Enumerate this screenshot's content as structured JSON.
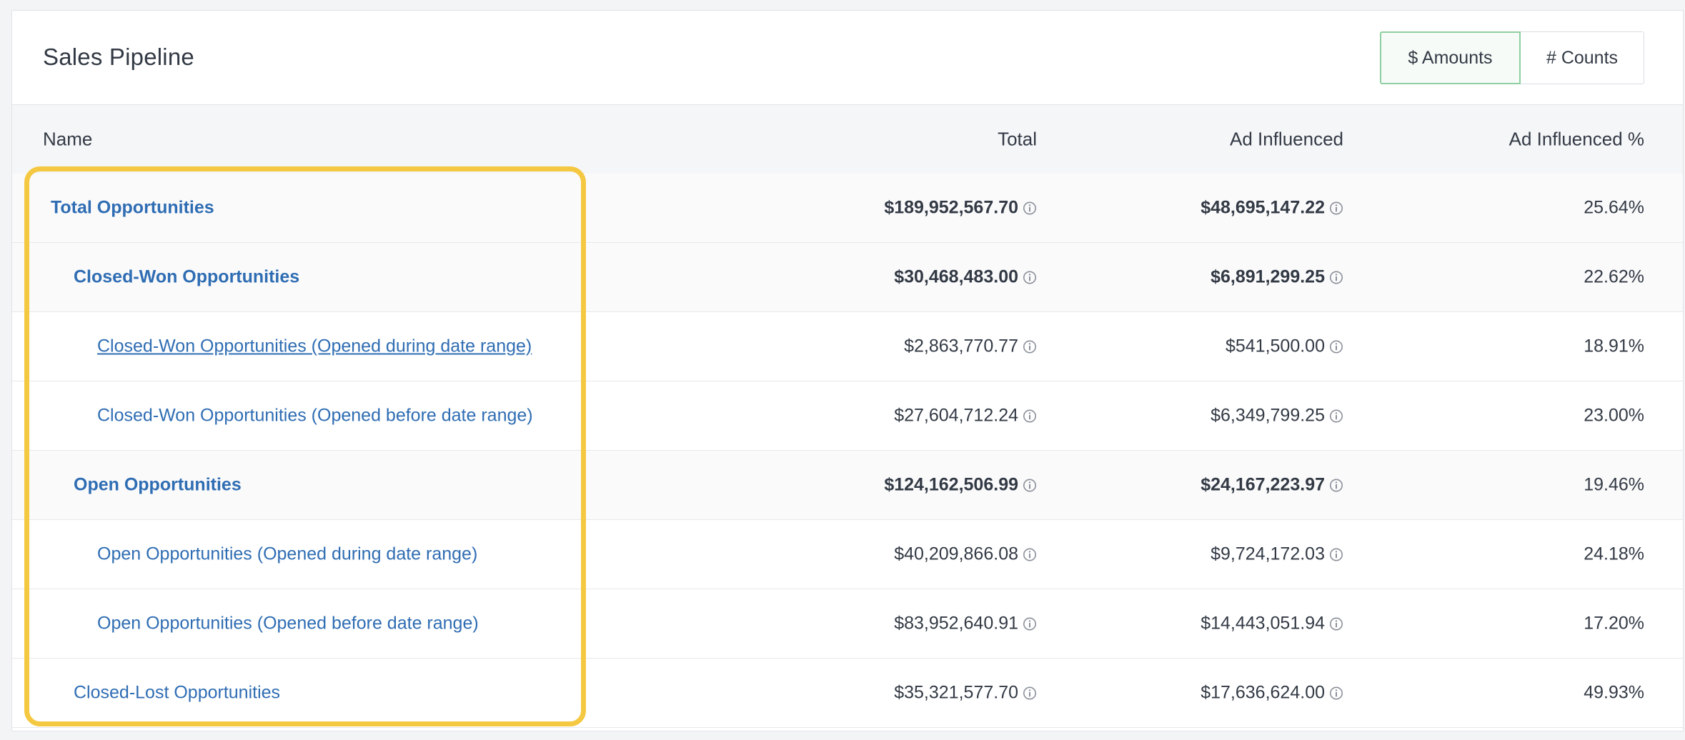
{
  "title": "Sales Pipeline",
  "toggle": {
    "amounts_label": "$ Amounts",
    "counts_label": "# Counts",
    "selected": "amounts"
  },
  "columns": {
    "name": "Name",
    "total": "Total",
    "ad_influenced": "Ad Influenced",
    "ad_influenced_pct": "Ad Influenced %"
  },
  "rows": [
    {
      "name": "Total Opportunities",
      "total": "$189,952,567.70",
      "ad": "$48,695,147.22",
      "pct": "25.64%"
    },
    {
      "name": "Closed-Won Opportunities",
      "total": "$30,468,483.00",
      "ad": "$6,891,299.25",
      "pct": "22.62%"
    },
    {
      "name": "Closed-Won Opportunities (Opened during date range)",
      "total": "$2,863,770.77",
      "ad": "$541,500.00",
      "pct": "18.91%"
    },
    {
      "name": "Closed-Won Opportunities (Opened before date range)",
      "total": "$27,604,712.24",
      "ad": "$6,349,799.25",
      "pct": "23.00%"
    },
    {
      "name": "Open Opportunities",
      "total": "$124,162,506.99",
      "ad": "$24,167,223.97",
      "pct": "19.46%"
    },
    {
      "name": "Open Opportunities (Opened during date range)",
      "total": "$40,209,866.08",
      "ad": "$9,724,172.03",
      "pct": "24.18%"
    },
    {
      "name": "Open Opportunities (Opened before date range)",
      "total": "$83,952,640.91",
      "ad": "$14,443,051.94",
      "pct": "17.20%"
    },
    {
      "name": "Closed-Lost Opportunities",
      "total": "$35,321,577.70",
      "ad": "$17,636,624.00",
      "pct": "49.93%"
    }
  ],
  "colors": {
    "link": "#2f6db3",
    "highlight": "#f5c842",
    "active_toggle_border": "#8fcfa1"
  },
  "icons": {
    "cell_info": "info-circle-icon"
  }
}
